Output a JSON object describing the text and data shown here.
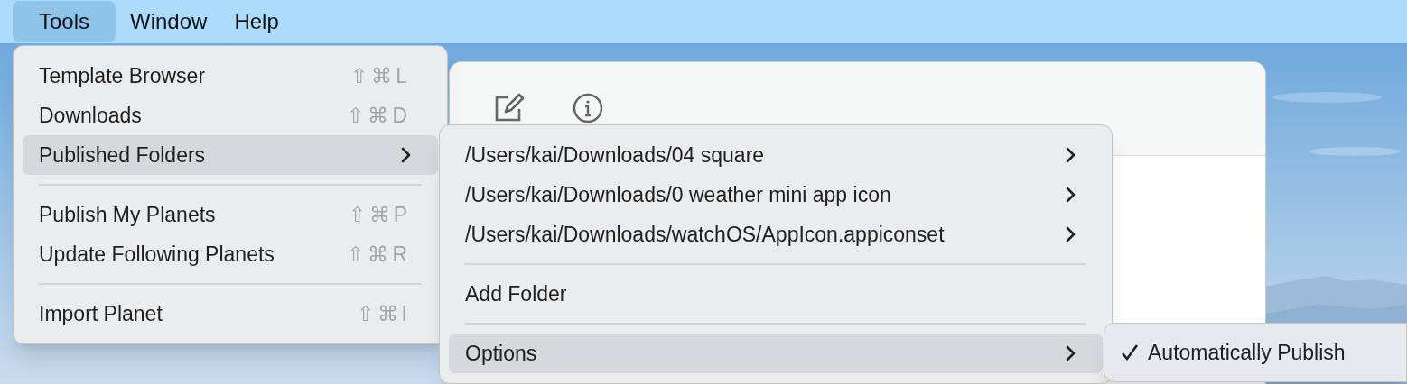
{
  "menu_bar": {
    "items": [
      {
        "label": "Tools",
        "selected": true
      },
      {
        "label": "Window",
        "selected": false
      },
      {
        "label": "Help",
        "selected": false
      }
    ]
  },
  "tools_menu": {
    "groups": [
      [
        {
          "label": "Template Browser",
          "shortcut": "⇧⌘L",
          "has_submenu": false,
          "selected": false
        },
        {
          "label": "Downloads",
          "shortcut": "⇧⌘D",
          "has_submenu": false,
          "selected": false
        },
        {
          "label": "Published Folders",
          "has_submenu": true,
          "selected": true
        }
      ],
      [
        {
          "label": "Publish My Planets",
          "shortcut": "⇧⌘P",
          "has_submenu": false,
          "selected": false
        },
        {
          "label": "Update Following Planets",
          "shortcut": "⇧⌘R",
          "has_submenu": false,
          "selected": false
        }
      ],
      [
        {
          "label": "Import Planet",
          "shortcut": "⇧⌘I",
          "has_submenu": false,
          "selected": false
        }
      ]
    ]
  },
  "folders_menu": {
    "groups": [
      [
        {
          "label": "/Users/kai/Downloads/04 square",
          "has_submenu": true,
          "selected": false
        },
        {
          "label": "/Users/kai/Downloads/0 weather mini app icon",
          "has_submenu": true,
          "selected": false
        },
        {
          "label": "/Users/kai/Downloads/watchOS/AppIcon.appiconset",
          "has_submenu": true,
          "selected": false
        }
      ],
      [
        {
          "label": "Add Folder",
          "has_submenu": false,
          "selected": false
        }
      ],
      [
        {
          "label": "Options",
          "has_submenu": true,
          "selected": true
        }
      ]
    ]
  },
  "options_menu": {
    "items": [
      {
        "label": "Automatically Publish",
        "checked": true
      }
    ]
  }
}
